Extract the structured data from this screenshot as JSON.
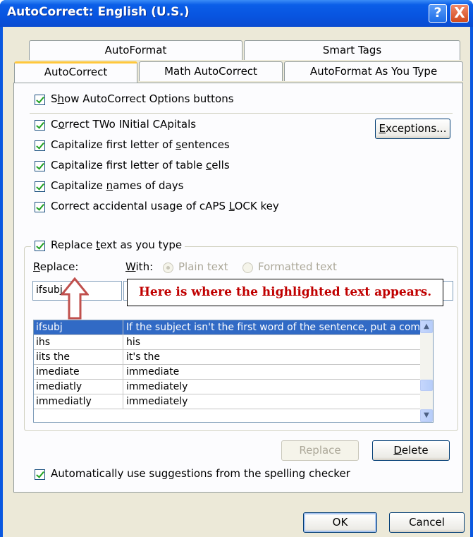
{
  "window": {
    "title": "AutoCorrect: English (U.S.)",
    "help_glyph": "?",
    "close_glyph": "X"
  },
  "tabs": {
    "row1": [
      "AutoFormat",
      "Smart Tags"
    ],
    "row2": [
      "AutoCorrect",
      "Math AutoCorrect",
      "AutoFormat As You Type"
    ],
    "active": "AutoCorrect"
  },
  "options": {
    "show_buttons": {
      "pre": "S",
      "key": "h",
      "post": "ow AutoCorrect Options buttons",
      "checked": true
    },
    "correct_two": {
      "pre": "C",
      "key": "o",
      "post": "rrect TWo INitial CApitals",
      "checked": true
    },
    "cap_sentences": {
      "pre": "Capitalize first letter of ",
      "key": "s",
      "post": "entences",
      "checked": true
    },
    "cap_cells": {
      "pre": "Capitalize first letter of table ",
      "key": "c",
      "post": "ells",
      "checked": true
    },
    "cap_days": {
      "pre": "Capitalize ",
      "key": "n",
      "post": "ames of days",
      "checked": true
    },
    "caps_lock": {
      "pre": "Correct accidental usage of cAPS ",
      "key": "L",
      "post": "OCK key",
      "checked": true
    },
    "exceptions": {
      "pre": "",
      "key": "E",
      "post": "xceptions..."
    }
  },
  "replace_group": {
    "checkbox": {
      "pre": "Replace ",
      "key": "t",
      "post": "ext as you type",
      "checked": true
    },
    "replace_label": {
      "key": "R",
      "post": "eplace:"
    },
    "with_label": {
      "key": "W",
      "post": "ith:"
    },
    "plain_text": "Plain text",
    "formatted_text": "Formatted text",
    "replace_value": "ifsubj",
    "with_value": ""
  },
  "annotation": "Here is where the highlighted text appears.",
  "entries": [
    {
      "from": "ifsubj",
      "to": "If the subject isn't the first word of the sentence, put a com"
    },
    {
      "from": "ihs",
      "to": "his"
    },
    {
      "from": "iits the",
      "to": "it's the"
    },
    {
      "from": "imediate",
      "to": "immediate"
    },
    {
      "from": "imediatly",
      "to": "immediately"
    },
    {
      "from": "immediatly",
      "to": "immediately"
    }
  ],
  "buttons": {
    "replace": "Replace",
    "delete_key": "D",
    "delete_rest": "elete",
    "ok": "OK",
    "cancel": "Cancel"
  },
  "spelling": {
    "text": "Automatically use suggestions from the spelling checker",
    "checked": true
  },
  "colors": {
    "selection": "#316ac5",
    "annotation_text": "#c00000",
    "titlebar": "#0a58e0"
  }
}
